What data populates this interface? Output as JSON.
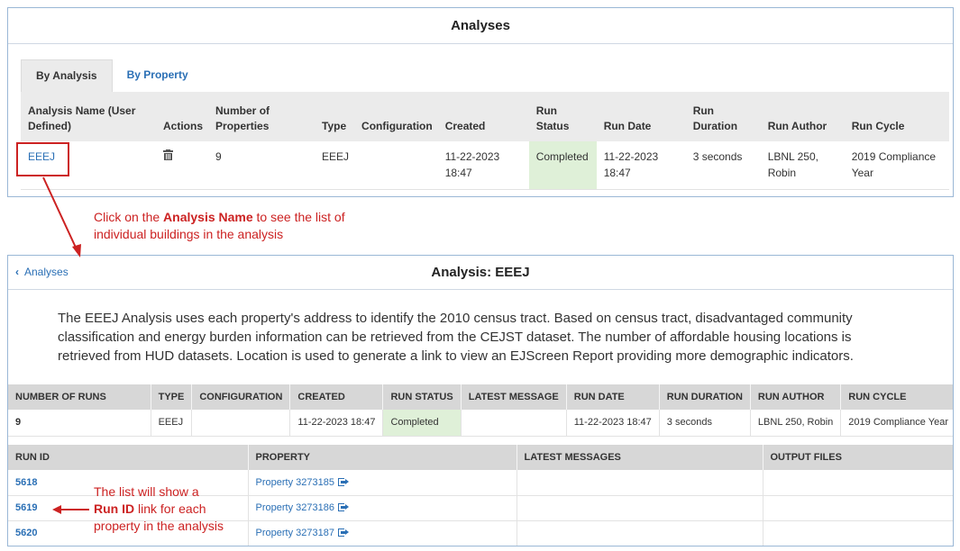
{
  "top": {
    "title": "Analyses",
    "tabs": [
      {
        "label": "By Analysis",
        "active": true
      },
      {
        "label": "By Property",
        "active": false
      }
    ],
    "columns": [
      "Analysis Name (User Defined)",
      "Actions",
      "Number of Properties",
      "Type",
      "Configuration",
      "Created",
      "Run Status",
      "Run Date",
      "Run Duration",
      "Run Author",
      "Run Cycle"
    ],
    "row": {
      "name": "EEEJ",
      "actions_icon": "trash-icon",
      "properties": "9",
      "type": "EEEJ",
      "configuration": "",
      "created": "11-22-2023 18:47",
      "status": "Completed",
      "run_date": "11-22-2023 18:47",
      "duration": "3 seconds",
      "author": "LBNL 250, Robin",
      "cycle": "2019 Compliance Year"
    }
  },
  "callout1": {
    "prefix": "Click on the ",
    "bold": "Analysis Name",
    "suffix": " to see the list of individual buildings in the analysis"
  },
  "detail": {
    "back_label": "Analyses",
    "title": "Analysis: EEEJ",
    "description": "The EEEJ Analysis uses each property's address to identify the 2010 census tract. Based on census tract, disadvantaged community classification and energy burden information can be retrieved from the CEJST dataset. The number of affordable housing locations is retrieved from HUD datasets. Location is used to generate a link to view an EJScreen Report providing more demographic indicators.",
    "summary_columns": [
      "NUMBER OF RUNS",
      "TYPE",
      "CONFIGURATION",
      "CREATED",
      "RUN STATUS",
      "LATEST MESSAGE",
      "RUN DATE",
      "RUN DURATION",
      "RUN AUTHOR",
      "RUN CYCLE"
    ],
    "summary_row": {
      "runs": "9",
      "type": "EEEJ",
      "configuration": "",
      "created": "11-22-2023 18:47",
      "status": "Completed",
      "latest_message": "",
      "run_date": "11-22-2023 18:47",
      "duration": "3 seconds",
      "author": "LBNL 250, Robin",
      "cycle": "2019 Compliance Year"
    },
    "runs_columns": [
      "RUN ID",
      "PROPERTY",
      "LATEST MESSAGES",
      "OUTPUT FILES"
    ],
    "runs": [
      {
        "id": "5618",
        "property": "Property 3273185"
      },
      {
        "id": "5619",
        "property": "Property 3273186"
      },
      {
        "id": "5620",
        "property": "Property 3273187"
      }
    ]
  },
  "callout2": {
    "line1": "The list will show a",
    "bold": "Run ID",
    "line2_rest": " link for each",
    "line3": "property in the analysis"
  },
  "colors": {
    "accent": "#2a6fb5",
    "annotation": "#cc2222",
    "completed_bg": "#dff0d8"
  }
}
